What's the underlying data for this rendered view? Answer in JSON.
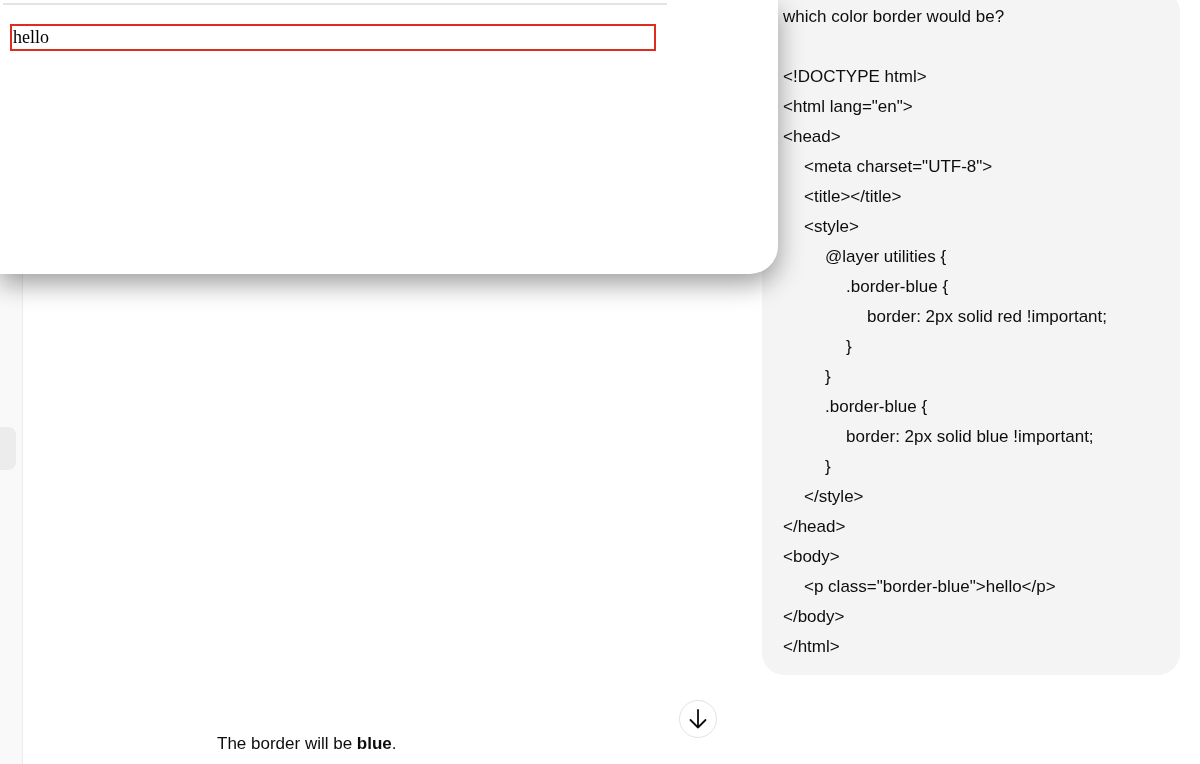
{
  "preview_window": {
    "paragraph": "hello"
  },
  "user_message": {
    "question": "which color border would be?",
    "code_lines": [
      "<!DOCTYPE html>",
      "<html lang=\"en\">",
      "<head>",
      "\t<meta charset=\"UTF-8\">",
      "\t<title></title>",
      "\t<style>",
      "\t\t@layer utilities {",
      "\t\t\t.border-blue {",
      "\t\t\t\tborder: 2px solid red !important;",
      "\t\t\t}",
      "\t\t}",
      "\t\t.border-blue {",
      "\t\t\tborder: 2px solid blue !important;",
      "\t\t}",
      "\t</style>",
      "</head>",
      "<body>",
      "\t<p class=\"border-blue\">hello</p>",
      "</body>",
      "</html>"
    ]
  },
  "assistant_message": {
    "text": "The border will be **blue**."
  }
}
